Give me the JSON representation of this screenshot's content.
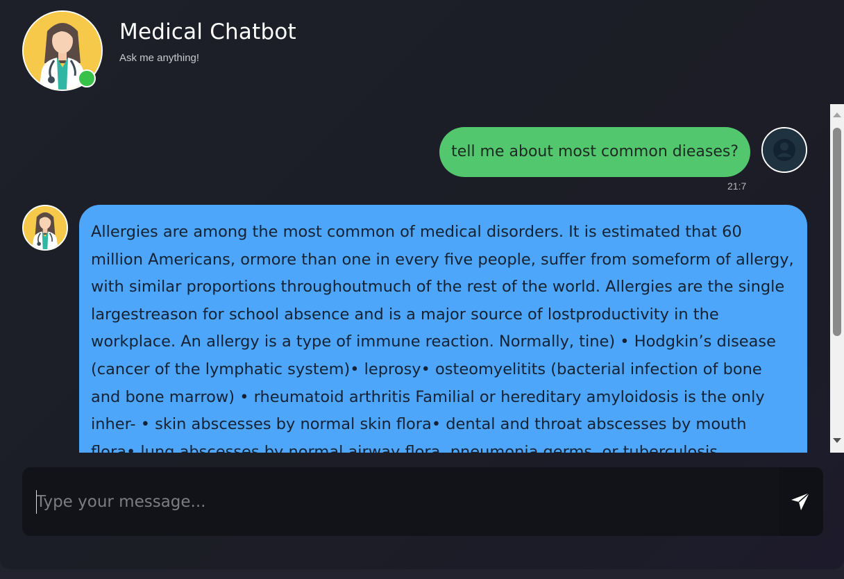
{
  "header": {
    "title": "Medical Chatbot",
    "subtitle": "Ask me anything!",
    "bot_avatar_icon": "doctor-avatar-icon",
    "status_color": "#39c24a"
  },
  "messages": {
    "user": {
      "text": "tell me about most common dieases?",
      "time": "21:7",
      "avatar_icon": "user-icon",
      "bubble_color": "#53c76d"
    },
    "bot": {
      "text": "Allergies are among the most common of medical disorders. It is estimated that 60 million Americans, ormore than one in every five people, suffer from someform of allergy, with similar proportions throughoutmuch of the rest of the world. Allergies are the single largestreason for school absence and is a major source of lostproductivity in the workplace. An allergy is a type of immune reaction. Normally, tine) • Hodgkin’s disease (cancer of the lymphatic system)• leprosy• osteomyelitits (bacterial infection of bone and bone marrow) • rheumatoid arthritis Familial or hereditary amyloidosis is the only inher- • skin abscesses by normal skin flora• dental and throat abscesses by mouth flora• lung abscesses by normal airway flora, pneumonia germs, or tuberculosis",
      "avatar_icon": "doctor-avatar-icon",
      "bubble_color": "#4ea6fa"
    }
  },
  "composer": {
    "placeholder": "Type your message...",
    "value": "",
    "send_icon": "send-icon"
  }
}
